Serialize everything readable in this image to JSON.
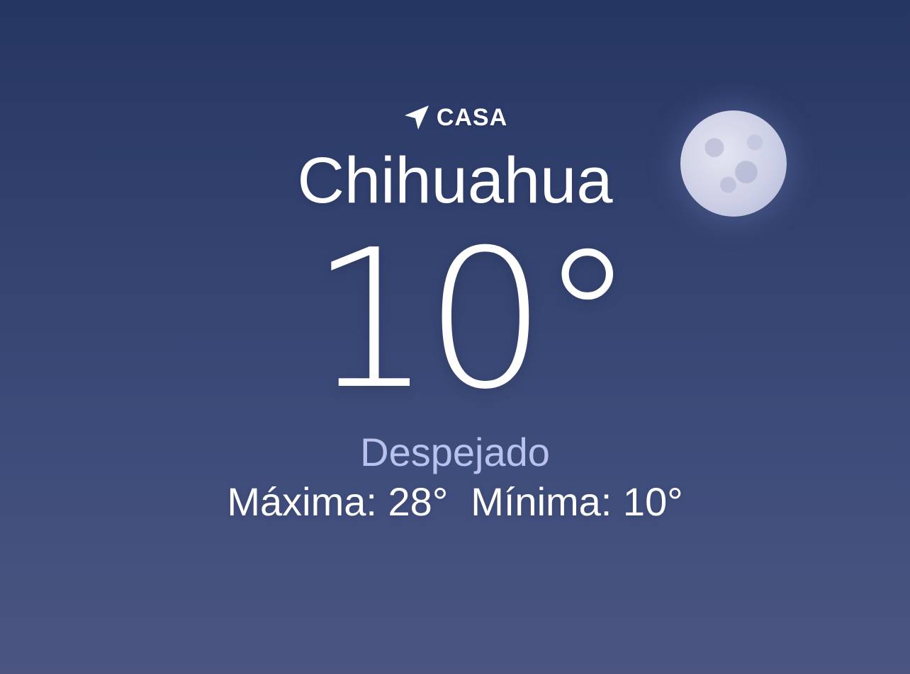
{
  "location": {
    "label": "CASA",
    "icon": "location-arrow-icon",
    "city": "Chihuahua"
  },
  "current": {
    "temperature": "10°",
    "condition": "Despejado",
    "high": "Máxima: 28°",
    "low": "Mínima: 10°"
  },
  "visual": {
    "icon": "moon-icon",
    "background_top": "#263663",
    "background_bottom": "#4b5580",
    "condition_color": "#b8c2ec"
  }
}
